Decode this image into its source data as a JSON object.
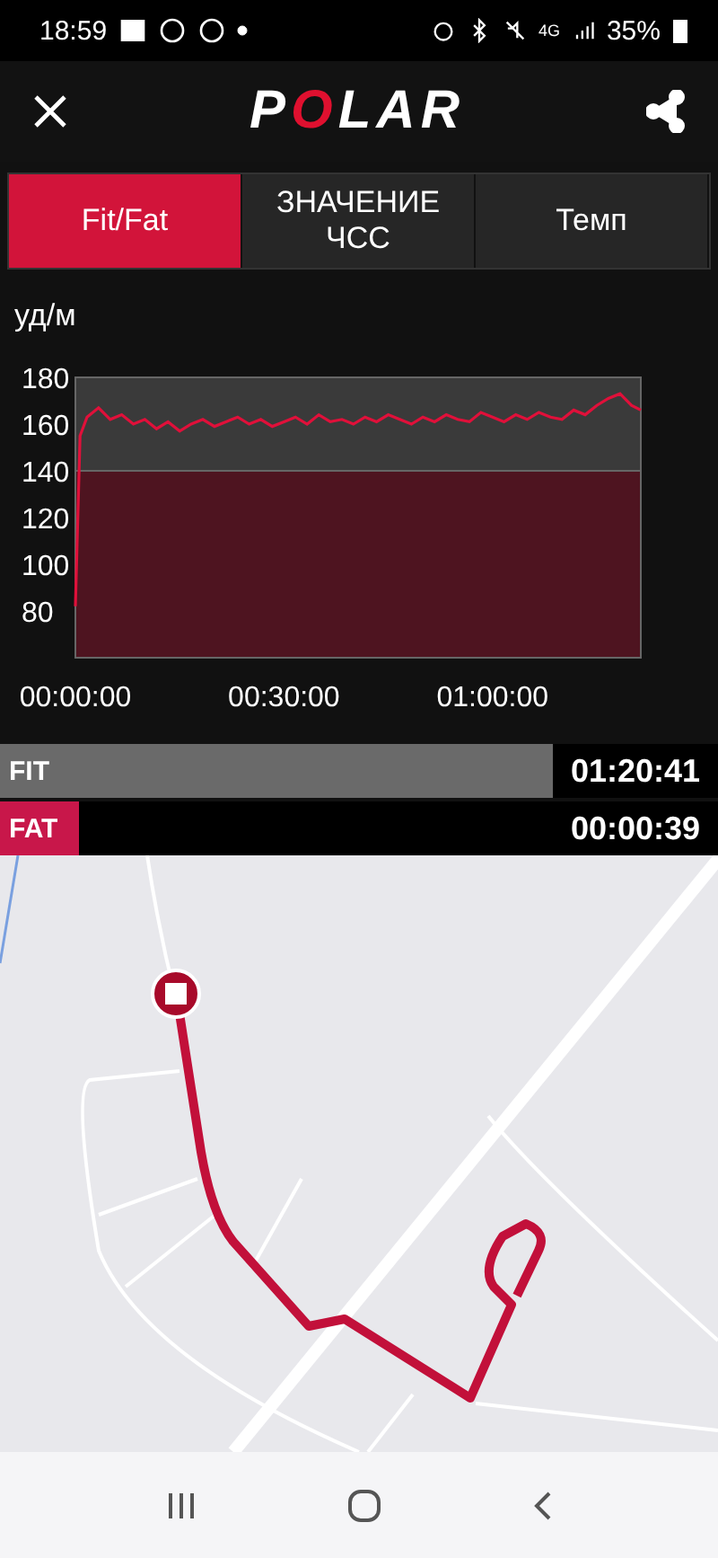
{
  "status_bar": {
    "time": "18:59",
    "network": "4G",
    "battery": "35%"
  },
  "header": {
    "logo": "POLAR"
  },
  "tabs": [
    {
      "label": "Fit/Fat",
      "selected": true
    },
    {
      "label": "ЗНАЧЕНИЕ ЧСС",
      "selected": false
    },
    {
      "label": "Темп",
      "selected": false
    }
  ],
  "chart": {
    "chart_data": {
      "type": "line",
      "ylabel": "уд/м",
      "xlim": [
        0,
        4880
      ],
      "ylim": [
        60,
        180
      ],
      "yticks": [
        80,
        100,
        120,
        140,
        160,
        180
      ],
      "xticks": [
        {
          "value": 0,
          "label": "00:00:00"
        },
        {
          "value": 1800,
          "label": "00:30:00"
        },
        {
          "value": 3600,
          "label": "01:00:00"
        }
      ],
      "x": [
        0,
        40,
        100,
        200,
        300,
        400,
        500,
        600,
        700,
        800,
        900,
        1000,
        1100,
        1200,
        1300,
        1400,
        1500,
        1600,
        1700,
        1800,
        1900,
        2000,
        2100,
        2200,
        2300,
        2400,
        2500,
        2600,
        2700,
        2800,
        2900,
        3000,
        3100,
        3200,
        3300,
        3400,
        3500,
        3600,
        3700,
        3800,
        3900,
        4000,
        4100,
        4200,
        4300,
        4400,
        4500,
        4600,
        4700,
        4800,
        4880
      ],
      "series": [
        {
          "color": "#e0103a",
          "values": [
            82,
            155,
            163,
            167,
            162,
            164,
            160,
            162,
            158,
            161,
            157,
            160,
            162,
            159,
            161,
            163,
            160,
            162,
            159,
            161,
            163,
            160,
            164,
            161,
            162,
            160,
            163,
            161,
            164,
            162,
            160,
            163,
            161,
            164,
            162,
            161,
            165,
            163,
            161,
            164,
            162,
            165,
            163,
            162,
            166,
            164,
            168,
            171,
            173,
            168,
            166
          ]
        }
      ]
    }
  },
  "zones": [
    {
      "label": "FIT",
      "time": "01:20:41",
      "level": 0.77,
      "color": "#6a6a6a"
    },
    {
      "label": "FAT",
      "time": "00:00:39",
      "level": 0.11,
      "color": "#c8174a"
    }
  ]
}
